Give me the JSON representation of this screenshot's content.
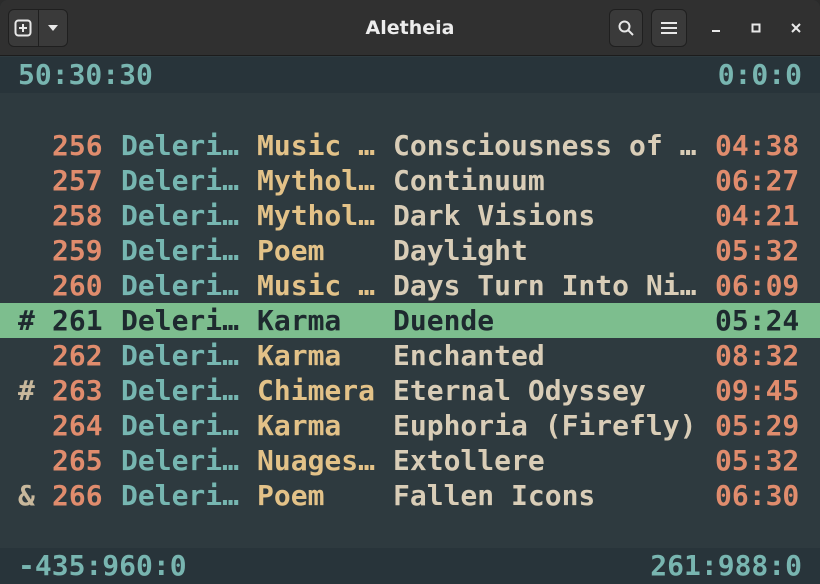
{
  "window": {
    "title": "Aletheia"
  },
  "header": {
    "new_icon": "plus-square-icon",
    "dropdown_icon": "chevron-down-icon",
    "search_icon": "search-icon",
    "menu_icon": "hamburger-menu-icon",
    "minimize_icon": "minimize-icon",
    "maximize_icon": "maximize-icon",
    "close_icon": "close-icon"
  },
  "status_top": {
    "left": "50:30:30",
    "right": "0:0:0"
  },
  "tracks": [
    {
      "mark": "",
      "num": "256",
      "artist": "Deleri…",
      "album": "Music …",
      "title": "Consciousness of …",
      "duration": "04:38",
      "current": false
    },
    {
      "mark": "",
      "num": "257",
      "artist": "Deleri…",
      "album": "Mythol…",
      "title": "Continuum",
      "duration": "06:27",
      "current": false
    },
    {
      "mark": "",
      "num": "258",
      "artist": "Deleri…",
      "album": "Mythol…",
      "title": "Dark Visions",
      "duration": "04:21",
      "current": false
    },
    {
      "mark": "",
      "num": "259",
      "artist": "Deleri…",
      "album": "Poem",
      "title": "Daylight",
      "duration": "05:32",
      "current": false
    },
    {
      "mark": "",
      "num": "260",
      "artist": "Deleri…",
      "album": "Music …",
      "title": "Days Turn Into Ni…",
      "duration": "06:09",
      "current": false
    },
    {
      "mark": "#",
      "num": "261",
      "artist": "Deleri…",
      "album": "Karma",
      "title": "Duende",
      "duration": "05:24",
      "current": true
    },
    {
      "mark": "",
      "num": "262",
      "artist": "Deleri…",
      "album": "Karma",
      "title": "Enchanted",
      "duration": "08:32",
      "current": false
    },
    {
      "mark": "#",
      "num": "263",
      "artist": "Deleri…",
      "album": "Chimera",
      "title": "Eternal Odyssey",
      "duration": "09:45",
      "current": false
    },
    {
      "mark": "",
      "num": "264",
      "artist": "Deleri…",
      "album": "Karma",
      "title": "Euphoria (Firefly)",
      "duration": "05:29",
      "current": false
    },
    {
      "mark": "",
      "num": "265",
      "artist": "Deleri…",
      "album": "Nuages…",
      "title": "Extollere",
      "duration": "05:32",
      "current": false
    },
    {
      "mark": "&",
      "num": "266",
      "artist": "Deleri…",
      "album": "Poem",
      "title": "Fallen Icons",
      "duration": "06:30",
      "current": false
    }
  ],
  "status_bottom": {
    "left": "-435:960:0",
    "right": "261:988:0"
  },
  "colors": {
    "background": "#2e3a3f",
    "statusbar": "#28343a",
    "number": "#e08c6d",
    "artist": "#76b6b1",
    "album": "#e3c288",
    "title": "#d9cdb7",
    "highlight": "#7dbe8e"
  }
}
